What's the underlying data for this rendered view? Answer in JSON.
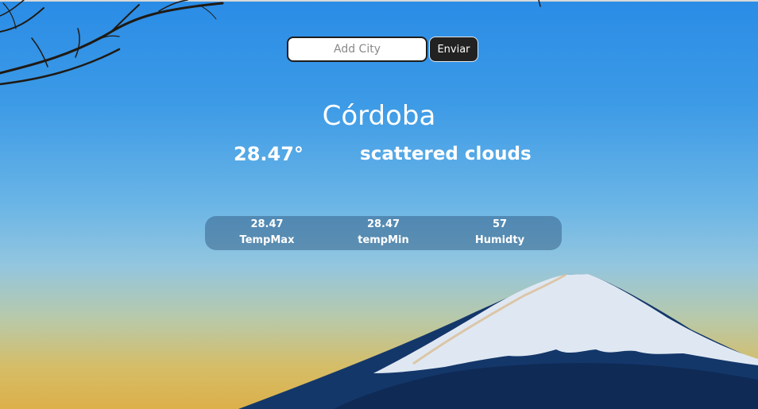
{
  "search": {
    "placeholder": "Add City",
    "value": "",
    "button_label": "Enviar"
  },
  "weather": {
    "city": "Córdoba",
    "temperature": "28.47°",
    "description": "scattered clouds"
  },
  "stats": [
    {
      "value": "28.47",
      "label": "TempMax"
    },
    {
      "value": "28.47",
      "label": "tempMin"
    },
    {
      "value": "57",
      "label": "Humidty"
    }
  ],
  "colors": {
    "sky_top": "#2a8ce6",
    "horizon": "#dcb04a",
    "button_bg": "#222222",
    "text": "#ffffff"
  }
}
